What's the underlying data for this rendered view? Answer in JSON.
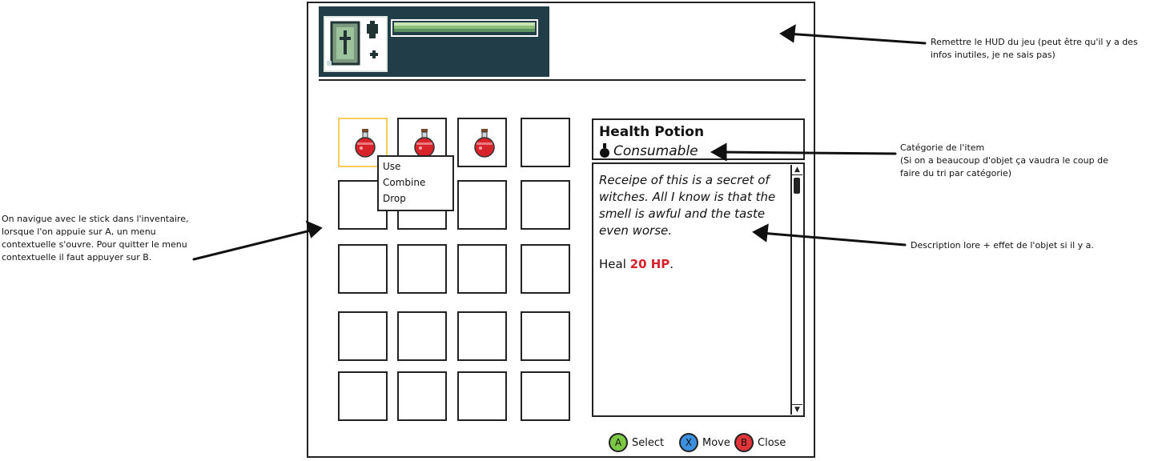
{
  "inventory": {
    "slots": [
      {
        "item": "potion",
        "selected": true
      },
      {
        "item": "potion",
        "selected": false
      },
      {
        "item": "potion",
        "selected": false
      },
      {
        "item": "",
        "selected": false
      }
    ],
    "context_menu": {
      "items": [
        "Use",
        "Combine",
        "Drop"
      ]
    }
  },
  "item_detail": {
    "name": "Health Potion",
    "category": "Consumable",
    "description": "Receipe of this is a secret of witches. All I know is that the smell is awful and the taste even worse.",
    "effect_prefix": "Heal ",
    "effect_value": "20 HP",
    "effect_suffix": "."
  },
  "buttons": {
    "select": {
      "letter": "A",
      "label": "Select",
      "color": "#7cc846"
    },
    "move": {
      "letter": "X",
      "label": "Move",
      "color": "#3d8fe0"
    },
    "close": {
      "letter": "B",
      "label": "Close",
      "color": "#e2353a"
    }
  },
  "annotations": {
    "hud": "Remettre le HUD du jeu (peut être qu'il y a des infos inutiles, je ne sais pas)",
    "category_title": "Catégorie de l'item",
    "category_detail": "(Si on a beaucoup d'objet ça vaudra le coup de faire du tri par catégorie)",
    "description": "Description lore + effet de l'objet si il y a.",
    "navigation": "On navigue avec le stick dans l'inventaire, lorsque l'on appuie sur A, un menu contextuelle s'ouvre. Pour quitter le menu contextuelle il faut appuyer sur B."
  },
  "colors": {
    "hud_bg": "#203d48",
    "selection": "#f4cd5c",
    "hp": "#d4222a",
    "potion_red": "#d9232b"
  }
}
